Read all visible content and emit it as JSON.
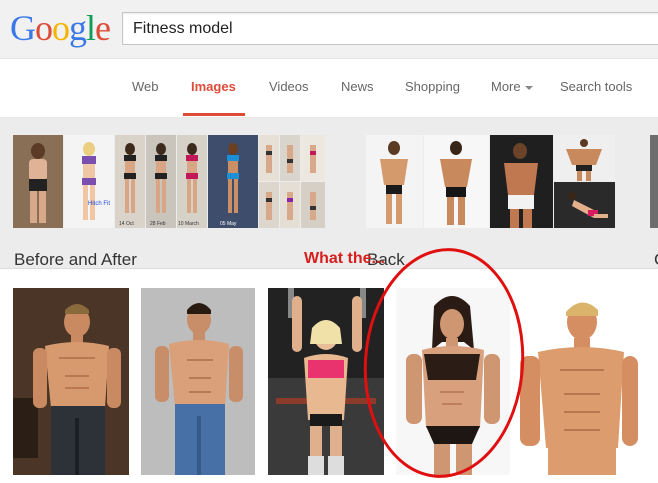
{
  "logo": {
    "letters": [
      "G",
      "o",
      "o",
      "g",
      "l",
      "e"
    ],
    "colors": [
      "#3b78e7",
      "#dd4b39",
      "#f4b400",
      "#3b78e7",
      "#0f9d58",
      "#dd4b39"
    ]
  },
  "search": {
    "value": "Fitness model"
  },
  "tabs": [
    {
      "label": "Web"
    },
    {
      "label": "Images",
      "active": true
    },
    {
      "label": "Videos"
    },
    {
      "label": "News"
    },
    {
      "label": "Shopping"
    },
    {
      "label": "More"
    },
    {
      "label": "Search tools"
    }
  ],
  "categories": [
    {
      "label": "Before and After"
    },
    {
      "label": "Back"
    },
    {
      "label": "C"
    }
  ],
  "thumb_captions": {
    "hitch_fit": "Hitch Fit",
    "dates": [
      "14 Oct",
      "28 Feb",
      "10 March",
      "05 May"
    ]
  },
  "annotation": {
    "text": "What the..."
  },
  "colors": {
    "accent": "#dd4b39",
    "annotation": "#d61f1f"
  }
}
